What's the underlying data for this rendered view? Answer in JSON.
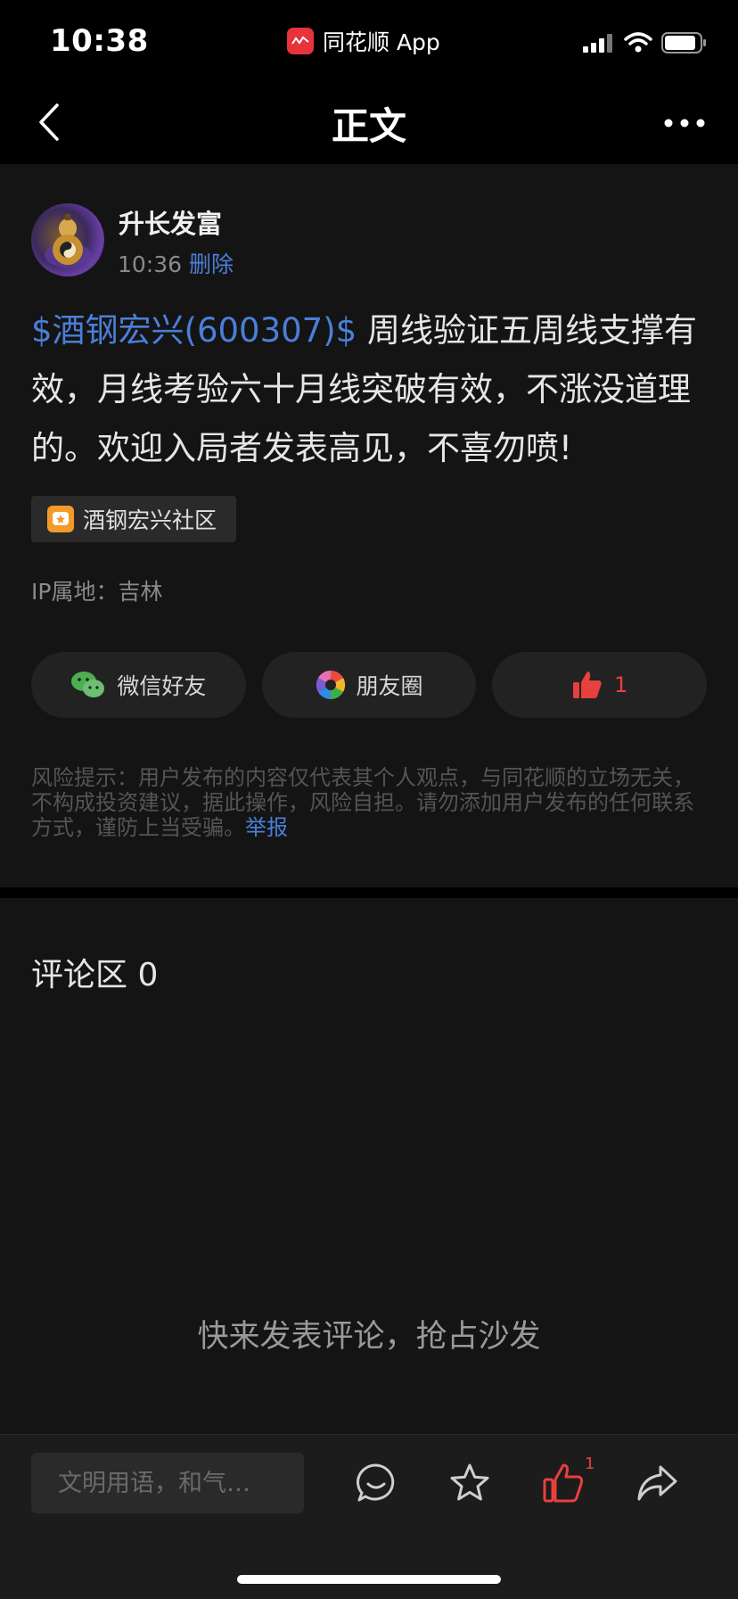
{
  "status_bar": {
    "time": "10:38",
    "app_name": "同花顺 App"
  },
  "nav": {
    "title": "正文"
  },
  "post": {
    "author": "升长发富",
    "time": "10:36",
    "delete_label": "删除",
    "stock_link": "$酒钢宏兴(600307)$",
    "body": " 周线验证五周线支撑有效，月线考验六十月线突破有效，不涨没道理的。欢迎入局者发表高见，不喜勿喷!",
    "community_tag": "酒钢宏兴社区",
    "ip_location": "IP属地：吉林"
  },
  "share": {
    "wechat_label": "微信好友",
    "moments_label": "朋友圈",
    "like_count": "1"
  },
  "risk": {
    "text": "风险提示：用户发布的内容仅代表其个人观点，与同花顺的立场无关，不构成投资建议，据此操作，风险自担。请勿添加用户发布的任何联系方式，谨防上当受骗。",
    "report_label": "举报"
  },
  "comments": {
    "title": "评论区",
    "count": "0",
    "empty_text": "快来发表评论，抢占沙发"
  },
  "bottom_bar": {
    "input_placeholder": "文明用语，和气…",
    "like_badge": "1"
  },
  "colors": {
    "accent_blue": "#4a7fd9",
    "like_red": "#e8403c",
    "background": "#141414"
  },
  "icons": [
    "back-icon",
    "more-icon",
    "wechat-icon",
    "moments-icon",
    "thumbs-up-icon",
    "comment-icon",
    "star-icon",
    "share-icon"
  ]
}
